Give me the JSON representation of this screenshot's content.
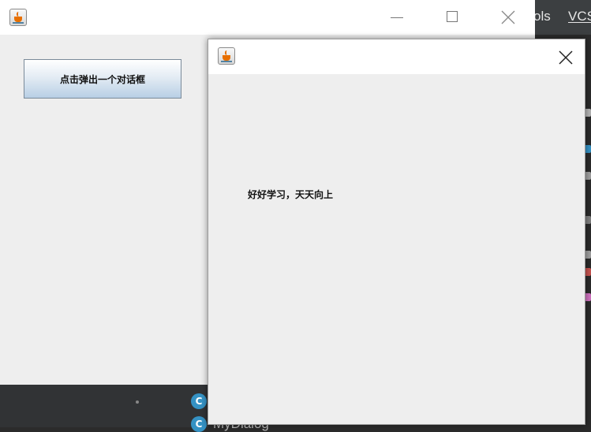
{
  "ide": {
    "menu_items": [
      "ols",
      "VCS"
    ],
    "bottom_class_label": "MyDialog",
    "run_icon_glyph": "C"
  },
  "main_window": {
    "open_button_label": "点击弹出一个对话框",
    "icons": [
      "java-icon",
      "minimize-icon",
      "maximize-icon",
      "close-icon"
    ]
  },
  "dialog": {
    "message": "好好学习，天天向上",
    "icons": [
      "java-icon",
      "close-icon"
    ]
  },
  "colors": {
    "ide_bg": "#2b2b2b",
    "window_bg": "#eeeeee",
    "title_bg": "#ffffff",
    "button_gradient_bottom": "#b8cfe5",
    "java_orange": "#e76f00",
    "java_blue": "#5382a1"
  }
}
